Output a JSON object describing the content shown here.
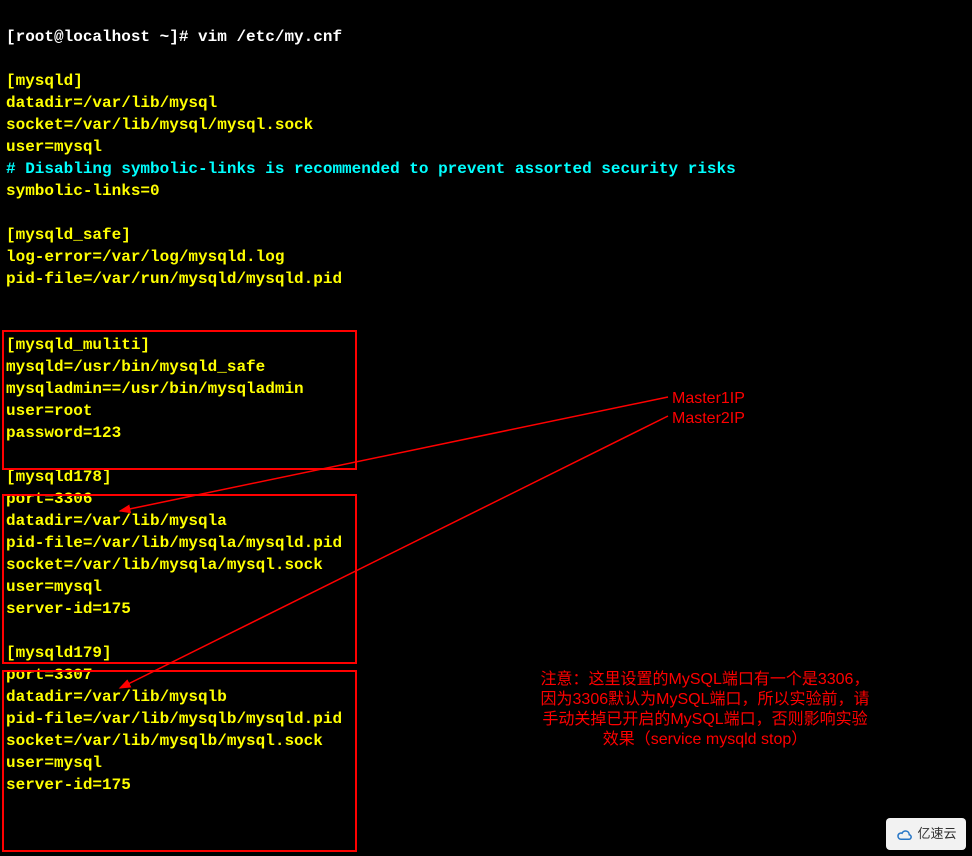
{
  "prompt": {
    "line": "[root@localhost ~]# vim /etc/my.cnf"
  },
  "cfg": {
    "sec1": "[mysqld]",
    "l1": "datadir=/var/lib/mysql",
    "l2": "socket=/var/lib/mysql/mysql.sock",
    "l3": "user=mysql",
    "comment": "# Disabling symbolic-links is recommended to prevent assorted security risks",
    "l4": "symbolic-links=0",
    "sec2": "[mysqld_safe]",
    "l5": "log-error=/var/log/mysqld.log",
    "l6": "pid-file=/var/run/mysqld/mysqld.pid",
    "sec3": "[mysqld_muliti]",
    "l7": "mysqld=/usr/bin/mysqld_safe",
    "l8": "mysqladmin==/usr/bin/mysqladmin",
    "l9": "user=root",
    "l10": "password=123",
    "sec4": "[mysqld178]",
    "l11": "port=3306",
    "l12": "datadir=/var/lib/mysqla",
    "l13": "pid-file=/var/lib/mysqla/mysqld.pid",
    "l14": "socket=/var/lib/mysqla/mysql.sock",
    "l15": "user=mysql",
    "l16": "server-id=175",
    "sec5": "[mysqld179]",
    "l17": "port=3307",
    "l18": "datadir=/var/lib/mysqlb",
    "l19": "pid-file=/var/lib/mysqlb/mysqld.pid",
    "l20": "socket=/var/lib/mysqlb/mysql.sock",
    "l21": "user=mysql",
    "l22": "server-id=175"
  },
  "labels": {
    "m1": "Master1IP",
    "m2": "Master2IP"
  },
  "note": {
    "l1": "注意：这里设置的MySQL端口有一个是3306，",
    "l2": "因为3306默认为MySQL端口，所以实验前，请",
    "l3": "手动关掉已开启的MySQL端口，否则影响实验",
    "l4": "效果（service mysqld stop）"
  },
  "watermark": "亿速云"
}
